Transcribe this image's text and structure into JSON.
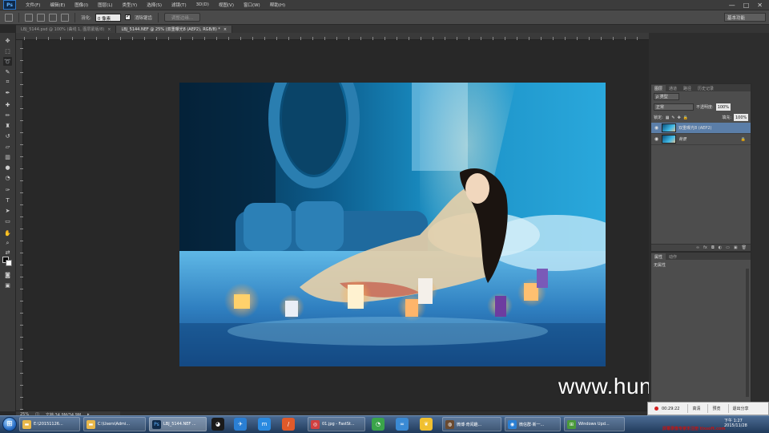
{
  "menubar": {
    "logo": "Ps",
    "items": [
      "文件(F)",
      "编辑(E)",
      "图像(I)",
      "图层(L)",
      "类型(Y)",
      "选择(S)",
      "滤镜(T)",
      "3D(D)",
      "视图(V)",
      "窗口(W)",
      "帮助(H)"
    ],
    "win_controls": [
      "—",
      "□",
      "✕"
    ]
  },
  "options": {
    "feather_label": "羽化:",
    "feather_value": "0 像素",
    "antialias_label": "消除锯齿",
    "refine_edge_label": "调整边缘...",
    "workspace": "基本功能"
  },
  "tabs": [
    {
      "label": "LBJ_5144.psd @ 100% (曲线 1, 图层蒙版/8)",
      "close": "×",
      "active": false
    },
    {
      "label": "LBJ_5144.NEF @ 25% (双重曝光8 (AEP2), RGB/8) *",
      "close": "×",
      "active": true
    }
  ],
  "status": {
    "zoom": "25%",
    "doc": "文档:34.9M/34.9M"
  },
  "layers_panel": {
    "tabs": [
      "图层",
      "通道",
      "路径",
      "历史记录"
    ],
    "kind_filter": "ρ 类型",
    "blend_mode": "正常",
    "opacity_label": "不透明度:",
    "opacity_value": "100%",
    "lock_label": "锁定:",
    "fill_label": "填充:",
    "fill_value": "100%",
    "layers": [
      {
        "name": "双重曝光8 (AEP2)",
        "visible": true,
        "selected": true,
        "locked": false
      },
      {
        "name": "背景",
        "visible": true,
        "selected": false,
        "locked": true
      }
    ],
    "footer_icons": [
      "∞",
      "fx",
      "◘",
      "◐",
      "▭",
      "▣",
      "🗑"
    ]
  },
  "props_panel": {
    "tabs": [
      "属性",
      "动作"
    ],
    "content": "无属性"
  },
  "watermark": "www.hunls.com",
  "recorder": {
    "time": "00:29:22",
    "buttons": [
      "高清",
      "预览",
      "退出分享"
    ],
    "brand": "屏幕录像专家未注册 tlxsoft.com"
  },
  "taskbar": {
    "tasks": [
      {
        "label": "E:\\20151126...",
        "active": false
      },
      {
        "label": "C:\\Users\\Admi...",
        "active": false
      },
      {
        "label": "LBJ_5144.NEF ...",
        "active": true
      },
      {
        "label": "01.jpg - FastSt...",
        "active": false
      },
      {
        "label": "微博·奇闻趣...",
        "active": false
      },
      {
        "label": "微信群·新一...",
        "active": false
      },
      {
        "label": "Windows Upd...",
        "active": false
      }
    ],
    "clock_time": "下午 1:27",
    "clock_date": "2015/11/28"
  }
}
